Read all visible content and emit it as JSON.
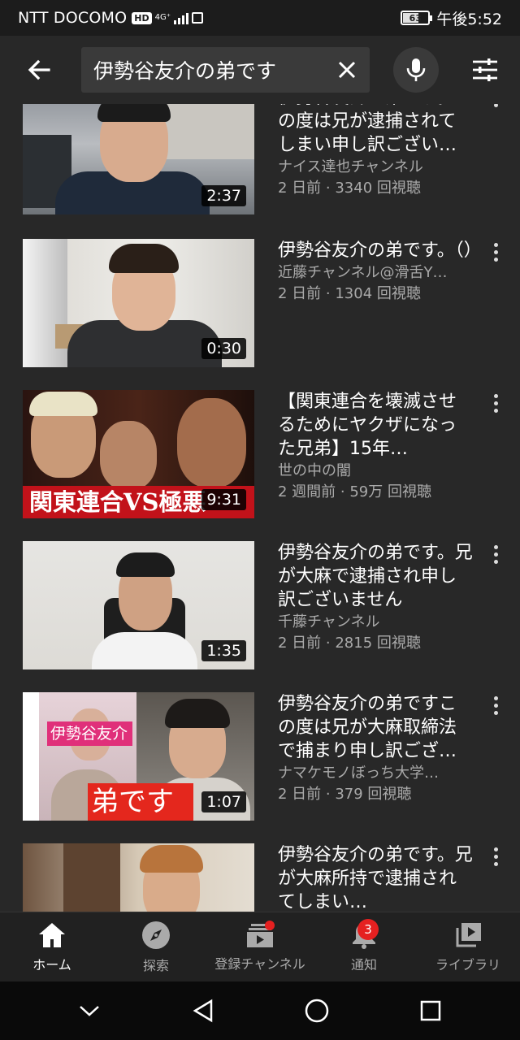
{
  "status_bar": {
    "carrier": "NTT DOCOMO",
    "hd": "HD",
    "network": "4G⁺",
    "battery": "63",
    "battery_level": 0.63,
    "time": "午後5:52"
  },
  "search": {
    "query": "伊勢谷友介の弟です"
  },
  "videos": [
    {
      "title": "伊勢谷友介の弟です。この度は兄が逮捕されてしまい申し訳ございません",
      "channel": "ナイス達也チャンネル",
      "meta": "2 日前 · 3340 回視聴",
      "duration": "2:37"
    },
    {
      "title": "伊勢谷友介の弟です。（）",
      "channel": "近藤チャンネル@滑舌Y…",
      "meta": "2 日前 · 1304 回視聴",
      "duration": "0:30"
    },
    {
      "title": "【関東連合を壊滅させるためにヤクザになった兄弟】15年…",
      "channel": "世の中の闇",
      "meta": "2 週間前 · 59万 回視聴",
      "duration": "9:31",
      "overlay": "関東連合VS極悪"
    },
    {
      "title": "伊勢谷友介の弟です。兄が大麻で逮捕され申し訳ございません",
      "channel": "千藤チャンネル",
      "meta": "2 日前 · 2815 回視聴",
      "duration": "1:35"
    },
    {
      "title": "伊勢谷友介の弟ですこの度は兄が大麻取締法で捕まり申し訳ございません",
      "channel": "ナマケモノぼっち大学…",
      "meta": "2 日前 · 379 回視聴",
      "duration": "1:07",
      "overlay_top": "伊勢谷友介",
      "overlay_bottom": "弟です"
    },
    {
      "title": "伊勢谷友介の弟です。兄が大麻所持で逮捕されてしまい…",
      "channel": "",
      "meta": "",
      "duration": ""
    }
  ],
  "bottom_nav": [
    {
      "label": "ホーム",
      "icon": "home-icon"
    },
    {
      "label": "探索",
      "icon": "compass-icon"
    },
    {
      "label": "登録チャンネル",
      "icon": "subscriptions-icon"
    },
    {
      "label": "通知",
      "icon": "bell-icon",
      "badge": "3"
    },
    {
      "label": "ライブラリ",
      "icon": "library-icon"
    }
  ],
  "colors": {
    "background": "#282828",
    "accent_red": "#e52020",
    "secondary_text": "#aaaaaa"
  }
}
